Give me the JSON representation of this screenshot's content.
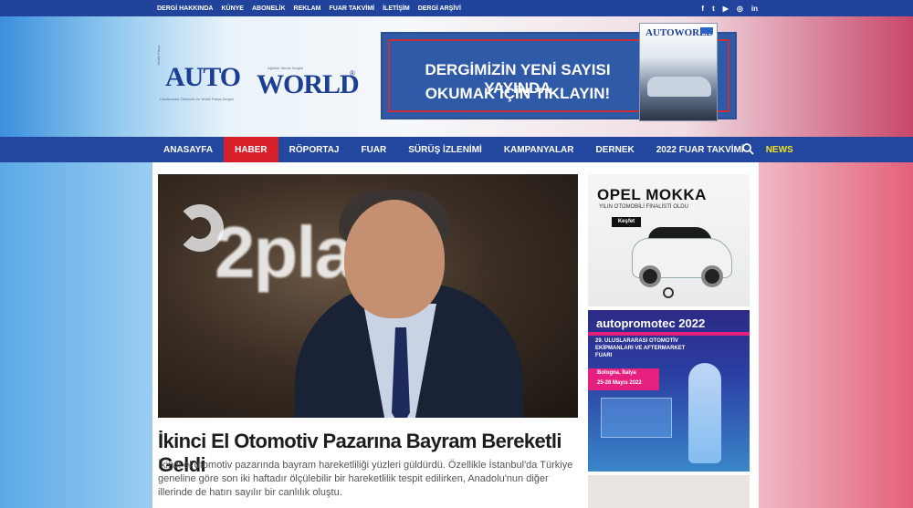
{
  "topbar": {
    "links": [
      "DERGİ HAKKINDA",
      "KÜNYE",
      "ABONELİK",
      "REKLAM",
      "FUAR TAKVİMİ",
      "İLETİŞİM",
      "DERGİ ARŞİVİ"
    ],
    "social": [
      "f",
      "t",
      "▶",
      "◎",
      "in"
    ]
  },
  "logo": {
    "small_top": "Yedek Parça",
    "auto": "AUTO",
    "world": "WORLD",
    "reg": "®",
    "tagline_left": "Uluslararası Otomotiv ve Yedek Parça Dergisi",
    "tagline_right": "Ağırlıklı Servis Dergisi"
  },
  "banner": {
    "line1": "DERGİMİZİN YENİ SAYISI YAYINDA",
    "line2": "OKUMAK İÇİN TIKLAYIN!",
    "magazine_title": "AUTOWORLD"
  },
  "mainnav": {
    "items": [
      {
        "label": "ANASAYFA"
      },
      {
        "label": "HABER",
        "active": true
      },
      {
        "label": "RÖPORTAJ"
      },
      {
        "label": "FUAR"
      },
      {
        "label": "SÜRÜŞ İZLENİMİ"
      },
      {
        "label": "KAMPANYALAR"
      },
      {
        "label": "DERNEK"
      },
      {
        "label": "2022 FUAR TAKVİMİ"
      },
      {
        "label": "NEWS"
      }
    ]
  },
  "article": {
    "hero_logo_text": "2pla",
    "title": "İkinci El Otomotiv Pazarına Bayram Bereketli Geldi",
    "excerpt": "İkinci el otomotiv pazarında bayram hareketliliği yüzleri güldürdü. Özellikle İstanbul'da Türkiye geneline göre son iki haftadır ölçülebilir bir hareketlilik tespit edilirken, Anadolu'nun diğer illerinde de hatırı sayılır bir canlılık oluştu."
  },
  "ads": {
    "opel": {
      "title": "OPEL MOKKA",
      "subtitle": "YILIN OTOMOBİLİ FİNALİSTİ OLDU",
      "button": "Keşfet",
      "brand": "OPEL"
    },
    "autopromotec": {
      "title": "autopromotec 2022",
      "desc": "29. ULUSLARARASI OTOMOTİV EKİPMANLARI VE AFTERMARKET FUARI",
      "city": "Bologna, İtalya",
      "dates": "25-28 Mayıs 2022"
    }
  },
  "colors": {
    "nav_blue": "#23479e",
    "active_red": "#d7202a",
    "news_yellow": "#f2e21f"
  }
}
